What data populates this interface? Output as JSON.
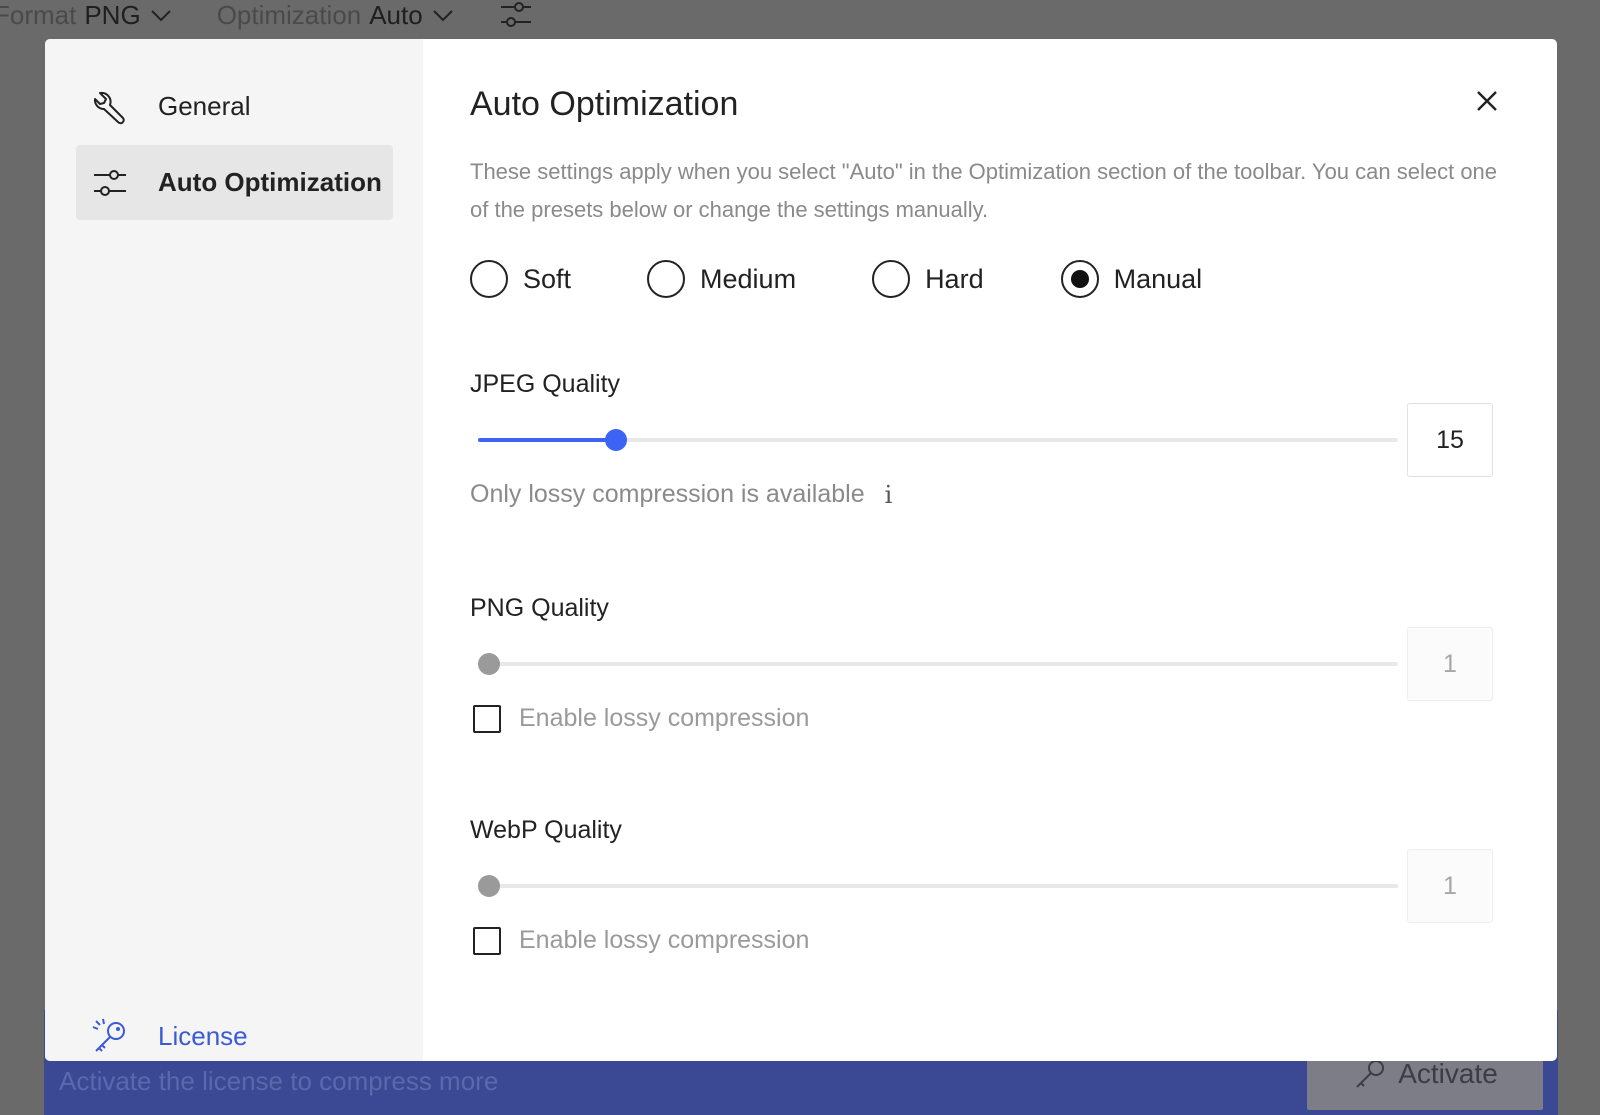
{
  "toolbar": {
    "format_label": "Format",
    "format_value": "PNG",
    "optimization_label": "Optimization",
    "optimization_value": "Auto"
  },
  "license_bar": {
    "message": "Activate the license to compress more",
    "activate_label": "Activate"
  },
  "sidebar": {
    "items": [
      {
        "label": "General",
        "icon": "wrench-icon"
      },
      {
        "label": "Auto Optimization",
        "icon": "sliders-icon"
      }
    ],
    "license_label": "License"
  },
  "dialog": {
    "title": "Auto Optimization",
    "description": "These settings apply when you select \"Auto\" in the Optimization section of the toolbar. You can select one of the presets below or change the settings manually.",
    "presets": [
      {
        "label": "Soft",
        "selected": false
      },
      {
        "label": "Medium",
        "selected": false
      },
      {
        "label": "Hard",
        "selected": false
      },
      {
        "label": "Manual",
        "selected": true
      }
    ],
    "jpeg": {
      "label": "JPEG Quality",
      "value": "15",
      "hint": "Only lossy compression is available",
      "info": "i"
    },
    "png": {
      "label": "PNG Quality",
      "value": "1",
      "checkbox": "Enable lossy compression"
    },
    "webp": {
      "label": "WebP Quality",
      "value": "1",
      "checkbox": "Enable lossy compression"
    }
  },
  "colors": {
    "accent": "#3d63f5",
    "license_bar": "#3b4994",
    "link": "#3a5ad6"
  }
}
